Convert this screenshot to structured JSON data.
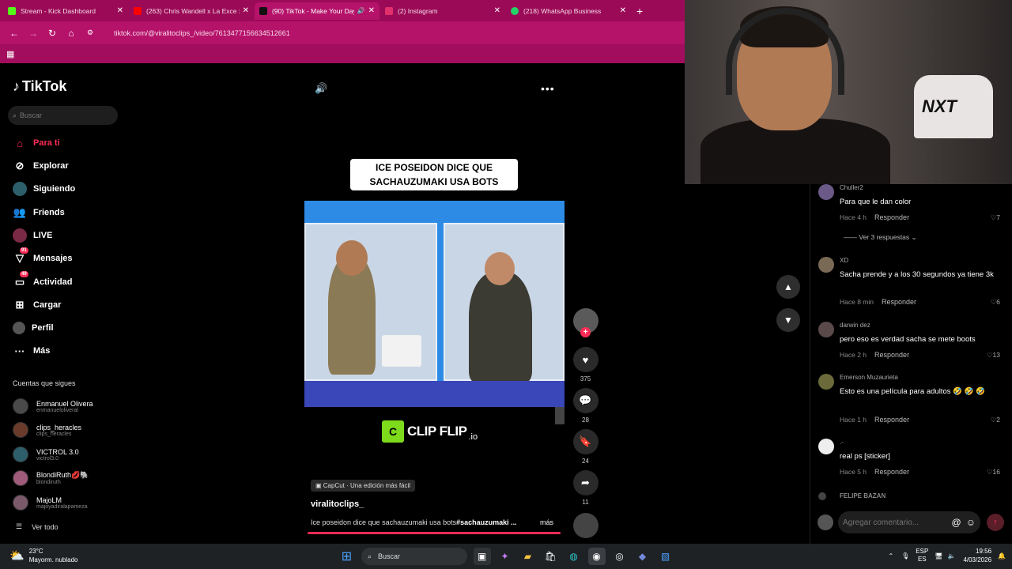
{
  "browser": {
    "tabs": [
      {
        "title": "Stream - Kick Dashboard",
        "color": "#53fc18"
      },
      {
        "title": "(263) Chris Wandell x La Exce x A",
        "color": "#ff0000"
      },
      {
        "title": "(90) TikTok - Make Your Day",
        "color": "#111111",
        "active": true
      },
      {
        "title": "(2) Instagram",
        "color": "#e1306c"
      },
      {
        "title": "(218) WhatsApp Business",
        "color": "#25d366"
      }
    ],
    "url": "tiktok.com/@viralitoclips_/video/7613477156634512661",
    "accent": "#b5126a"
  },
  "sidebar": {
    "logo": "TikTok",
    "search_placeholder": "Buscar",
    "nav": [
      {
        "label": "Para ti",
        "icon": "home-icon",
        "active": true
      },
      {
        "label": "Explorar",
        "icon": "compass-icon"
      },
      {
        "label": "Siguiendo",
        "icon": "following-icon"
      },
      {
        "label": "Friends",
        "icon": "friends-icon"
      },
      {
        "label": "LIVE",
        "icon": "live-icon"
      },
      {
        "label": "Mensajes",
        "icon": "messages-icon",
        "badge": "91"
      },
      {
        "label": "Actividad",
        "icon": "activity-icon",
        "badge": "49"
      },
      {
        "label": "Cargar",
        "icon": "upload-icon"
      },
      {
        "label": "Perfil",
        "icon": "profile-icon"
      },
      {
        "label": "Más",
        "icon": "more-icon"
      }
    ],
    "following_title": "Cuentas que sigues",
    "following": [
      {
        "name": "Enmanuel Olivera",
        "handle": "enmanueloliveral"
      },
      {
        "name": "clips_heracles",
        "handle": "clips_heracles"
      },
      {
        "name": "VICTROL 3.0",
        "handle": "victrol3.0"
      },
      {
        "name": "BlondiRuth💋🐘",
        "handle": "blondiruth"
      },
      {
        "name": "MajoLM",
        "handle": "majoyadiralapameza"
      }
    ],
    "see_all": "Ver todo"
  },
  "video": {
    "caption_line1": "ICE POSEIDON DICE QUE",
    "caption_line2": "SACHAUZUMAKI USA BOTS",
    "brand": "CLIP FLIP",
    "brand_suffix": ".io",
    "capcut": "CapCut · Una edición más fácil",
    "author": "viralitoclips_",
    "description": "Ice poseidon dice que sachauzumaki usa bots",
    "hashtag": "#sachauzumaki ...",
    "more": "más",
    "likes": "375",
    "comments": "28",
    "saves": "24",
    "shares": "11"
  },
  "comments": [
    {
      "user": "Chuller2",
      "text": "Para que le dan color",
      "time": "Hace 4 h",
      "reply": "Responder",
      "likes": "7",
      "replies": "Ver 3 respuestas"
    },
    {
      "user": "XD",
      "text": "Sacha prende y a los 30 segundos ya tiene 3k",
      "time": "Hace 8 min",
      "reply": "Responder",
      "likes": "6"
    },
    {
      "user": "darwin dez",
      "text": "pero eso es verdad sacha se mete boots",
      "time": "Hace 2 h",
      "reply": "Responder",
      "likes": "13"
    },
    {
      "user": "Emerson Muzaurieta",
      "text": "Esto es una película para adultos 🤣 🤣 🤣",
      "time": "Hace 1 h",
      "reply": "Responder",
      "likes": "2"
    },
    {
      "user": ".-",
      "text": "real ps [sticker]",
      "time": "Hace 5 h",
      "reply": "Responder",
      "likes": "16"
    },
    {
      "user": "FELIPE BAZAN"
    }
  ],
  "comment_input_placeholder": "Agregar comentario...",
  "taskbar": {
    "temp": "23°C",
    "weather": "Mayorm. nublado",
    "search": "Buscar",
    "lang1": "ESP",
    "lang2": "ES",
    "time": "19:56",
    "date": "4/03/2026"
  }
}
